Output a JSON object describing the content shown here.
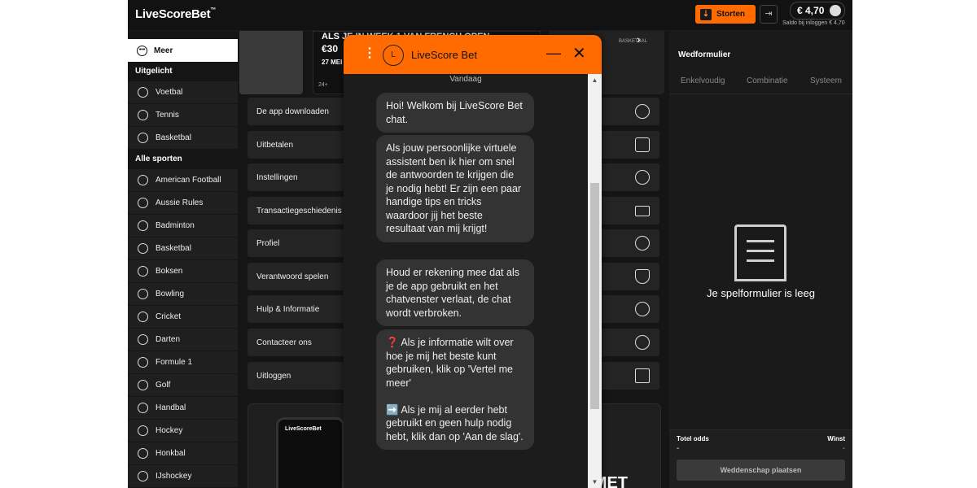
{
  "header": {
    "logo": "LiveScoreBet",
    "logo_tm": "™",
    "deposit_label": "Storten",
    "balance": "€ 4,70",
    "balance_sub": "Saldo bij inloggen € 4,70"
  },
  "sidebar": {
    "more_label": "Meer",
    "featured_heading": "Uitgelicht",
    "featured": [
      {
        "label": "Voetbal",
        "icon": "soccer-icon"
      },
      {
        "label": "Tennis",
        "icon": "tennis-icon"
      },
      {
        "label": "Basketbal",
        "icon": "basketball-icon"
      }
    ],
    "all_heading": "Alle sporten",
    "sports": [
      {
        "label": "American Football",
        "icon": "american-football-icon"
      },
      {
        "label": "Aussie Rules",
        "icon": "aussie-rules-icon"
      },
      {
        "label": "Badminton",
        "icon": "badminton-icon"
      },
      {
        "label": "Basketbal",
        "icon": "basketball-icon"
      },
      {
        "label": "Boksen",
        "icon": "boxing-icon"
      },
      {
        "label": "Bowling",
        "icon": "bowling-icon"
      },
      {
        "label": "Cricket",
        "icon": "cricket-icon"
      },
      {
        "label": "Darten",
        "icon": "darts-icon"
      },
      {
        "label": "Formule 1",
        "icon": "formula1-icon"
      },
      {
        "label": "Golf",
        "icon": "golf-icon"
      },
      {
        "label": "Handbal",
        "icon": "handball-icon"
      },
      {
        "label": "Hockey",
        "icon": "hockey-icon"
      },
      {
        "label": "Honkbal",
        "icon": "baseball-icon"
      },
      {
        "label": "IJshockey",
        "icon": "ice-hockey-icon"
      }
    ]
  },
  "banner": {
    "text_line1": "ALS JE IN WEEK 1 VAN FRENCH OPEN",
    "text_line2": "€30",
    "text_line3": "27 MEI",
    "tag": "24+",
    "side_label": "BASKETBAL"
  },
  "menu": {
    "items": [
      {
        "label": "De app downloaden",
        "icon": "download-icon"
      },
      {
        "label": "Uitbetalen",
        "icon": "upload-icon"
      },
      {
        "label": "Instellingen",
        "icon": "gear-icon"
      },
      {
        "label": "Transactiegeschiedenis",
        "icon": "card-icon"
      },
      {
        "label": "Profiel",
        "icon": "user-icon"
      },
      {
        "label": "Verantwoord spelen",
        "icon": "shield-icon"
      },
      {
        "label": "Hulp & Informatie",
        "icon": "help-icon"
      },
      {
        "label": "Contacteer ons",
        "icon": "chat-icon"
      },
      {
        "label": "Uitloggen",
        "icon": "logout-icon"
      }
    ]
  },
  "promo": {
    "phone_logo": "LiveScoreBet",
    "big_text": "MET"
  },
  "betslip": {
    "title": "Wedformulier",
    "tabs": [
      "Enkelvoudig",
      "Combinatie",
      "Systeem"
    ],
    "empty_text": "Je spelformulier is leeg",
    "odds_label": "Totel odds",
    "odds_value": "-",
    "win_label": "Winst",
    "win_value": "-",
    "place_label": "Weddenschap plaatsen"
  },
  "chat": {
    "title": "LiveScore Bet",
    "avatar_letter": "L",
    "date_label": "Vandaag",
    "messages": [
      "Hoi! Welkom bij LiveScore Bet chat.",
      "Als jouw persoonlijke virtuele assistent ben ik hier om snel de antwoorden te krijgen die je nodig hebt! Er zijn een paar handige tips en tricks waardoor jij het beste resultaat van mij krijgt!",
      "Houd er rekening mee dat als je de app gebruikt en het chatvenster verlaat, de chat wordt verbroken.",
      "❓ Als je informatie wilt over hoe je mij het beste kunt gebruiken, klik op 'Vertel me meer'\n\n➡️ Als je mij al eerder hebt gebruikt en geen hulp nodig hebt, klik dan op 'Aan de slag'."
    ]
  },
  "colors": {
    "accent": "#ff6b00",
    "background": "#151515",
    "success": "#3fcf6a"
  }
}
